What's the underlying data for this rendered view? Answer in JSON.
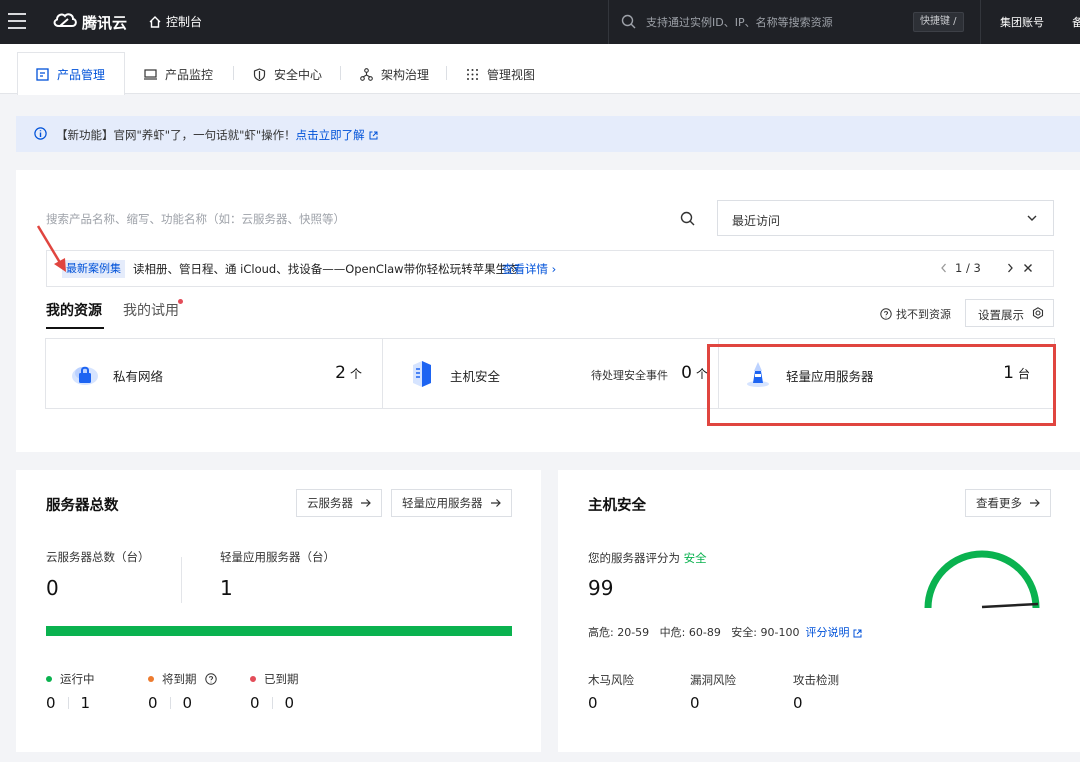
{
  "topbar": {
    "logo_text": "腾讯云",
    "console": "控制台",
    "search_placeholder": "支持通过实例ID、IP、名称等搜索资源",
    "shortcut": "快捷键 /",
    "group_account": "集团账号",
    "cut_label": "备"
  },
  "tabs": [
    {
      "label": "产品管理",
      "icon": "product-icon",
      "active": true
    },
    {
      "label": "产品监控",
      "icon": "monitor-icon"
    },
    {
      "label": "安全中心",
      "icon": "shield-icon"
    },
    {
      "label": "架构治理",
      "icon": "architecture-icon"
    },
    {
      "label": "管理视图",
      "icon": "grid-icon"
    }
  ],
  "notice": {
    "text": "【新功能】官网\"养虾\"了，一句话就\"虾\"操作！",
    "link": "点击立即了解"
  },
  "resources": {
    "search_placeholder": "搜索产品名称、缩写、功能名称（如：云服务器、快照等）",
    "recent": "最近访问",
    "case_tag": "最新案例集",
    "case_text": "读相册、管日程、通 iCloud、找设备——OpenClaw带你轻松玩转苹果生态",
    "case_more": "查看详情",
    "case_page": "1 / 3",
    "tab_mine": "我的资源",
    "tab_trial": "我的试用",
    "not_found": "找不到资源",
    "settings": "设置展示",
    "tiles": [
      {
        "name": "私有网络",
        "value": "2",
        "unit": "个",
        "icon": "vpc-icon"
      },
      {
        "name": "主机安全",
        "sub": "待处理安全事件",
        "value": "0",
        "unit": "个",
        "icon": "host-security-icon"
      },
      {
        "name": "轻量应用服务器",
        "value": "1",
        "unit": "台",
        "icon": "lighthouse-icon"
      }
    ]
  },
  "server": {
    "title": "服务器总数",
    "btn_cvm": "云服务器",
    "btn_lh": "轻量应用服务器",
    "cvm_label": "云服务器总数（台）",
    "cvm_value": "0",
    "lh_label": "轻量应用服务器（台）",
    "lh_value": "1",
    "running": "运行中",
    "expiring": "将到期",
    "expired": "已到期",
    "running_a": "0",
    "running_b": "1",
    "expiring_a": "0",
    "expiring_b": "0",
    "expired_a": "0",
    "expired_b": "0",
    "colors": {
      "running": "#0ab24f",
      "expiring": "#ed7b2f",
      "expired": "#e34d59"
    }
  },
  "host": {
    "title": "主机安全",
    "more": "查看更多",
    "score_label": "您的服务器评分为",
    "score_status": "安全",
    "score": "99",
    "ranges": "高危: 20-59   中危: 60-89   安全: 90-100",
    "range_link": "评分说明",
    "trojan": "木马风险",
    "vuln": "漏洞风险",
    "attack": "攻击检测",
    "trojan_v": "0",
    "vuln_v": "0",
    "attack_v": "0"
  },
  "colors": {
    "brand": "#0052d9",
    "topbar": "#1f2126",
    "success": "#0ab24f",
    "highlight": "#e0453f"
  }
}
